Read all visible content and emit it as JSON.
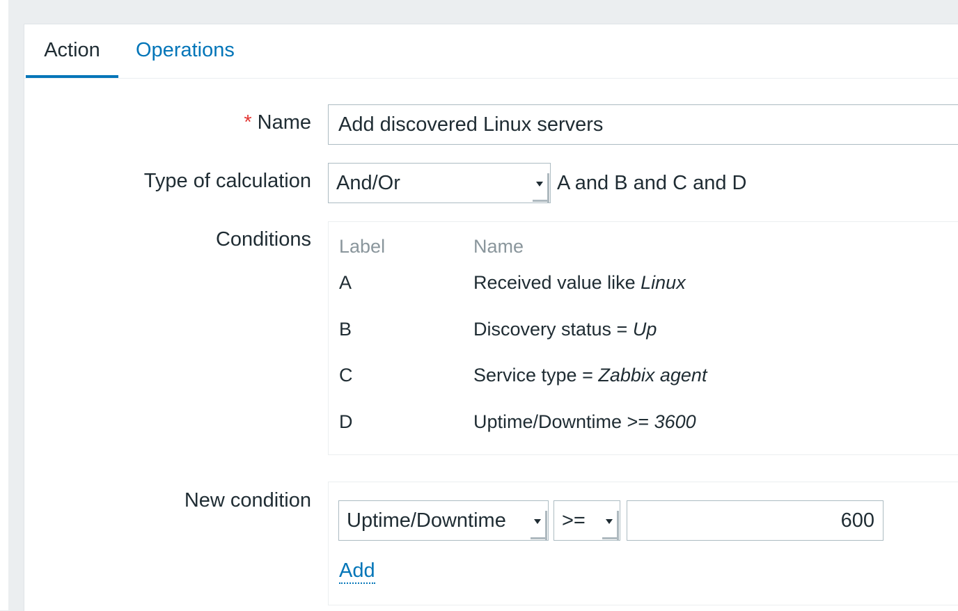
{
  "tabs": [
    {
      "label": "Action",
      "active": true
    },
    {
      "label": "Operations",
      "active": false
    }
  ],
  "form": {
    "name": {
      "required_marker": "*",
      "label": "Name",
      "value": "Add discovered Linux servers"
    },
    "type_of_calculation": {
      "label": "Type of calculation",
      "selected": "And/Or",
      "expression": "A and B and C and D"
    },
    "conditions": {
      "label": "Conditions",
      "headers": {
        "label": "Label",
        "name": "Name"
      },
      "rows": [
        {
          "label": "A",
          "name_prefix": "Received value like ",
          "name_value": "Linux"
        },
        {
          "label": "B",
          "name_prefix": "Discovery status = ",
          "name_value": "Up"
        },
        {
          "label": "C",
          "name_prefix": "Service type = ",
          "name_value": "Zabbix agent"
        },
        {
          "label": "D",
          "name_prefix": "Uptime/Downtime >= ",
          "name_value": "3600"
        }
      ]
    },
    "new_condition": {
      "label": "New condition",
      "type_selected": "Uptime/Downtime",
      "operator_selected": ">=",
      "value": "600",
      "add_label": "Add"
    }
  },
  "colors": {
    "accent": "#0275b8",
    "required": "#e33734",
    "background": "#ebeef0",
    "muted": "#8a969c"
  }
}
